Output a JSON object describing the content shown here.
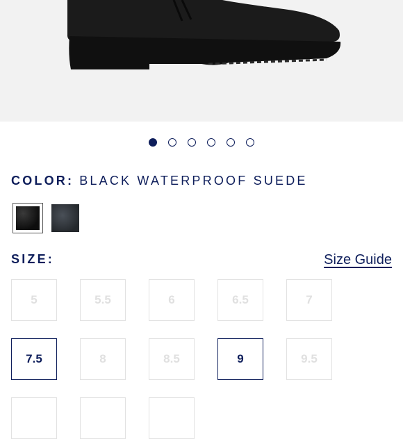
{
  "product": {
    "image_alt": "black waterproof suede boot",
    "carousel": {
      "count": 6,
      "active_index": 0
    }
  },
  "color": {
    "label": "COLOR:",
    "value": "BLACK WATERPROOF SUEDE",
    "swatches": [
      {
        "name": "black-waterproof-suede",
        "selected": true
      },
      {
        "name": "dark-grey-suede",
        "selected": false
      }
    ]
  },
  "size": {
    "label": "SIZE:",
    "guide_label": "Size Guide",
    "options": [
      {
        "label": "5",
        "available": false
      },
      {
        "label": "5.5",
        "available": false
      },
      {
        "label": "6",
        "available": false
      },
      {
        "label": "6.5",
        "available": false
      },
      {
        "label": "7",
        "available": false
      },
      {
        "label": "7.5",
        "available": true
      },
      {
        "label": "8",
        "available": false
      },
      {
        "label": "8.5",
        "available": false
      },
      {
        "label": "9",
        "available": true
      },
      {
        "label": "9.5",
        "available": false
      },
      {
        "label": "",
        "available": false
      },
      {
        "label": "",
        "available": false
      },
      {
        "label": "",
        "available": false
      }
    ]
  },
  "colors": {
    "navy": "#0e1e5b",
    "disabled_border": "#e2e2e2",
    "disabled_text": "#e0e0e0"
  }
}
